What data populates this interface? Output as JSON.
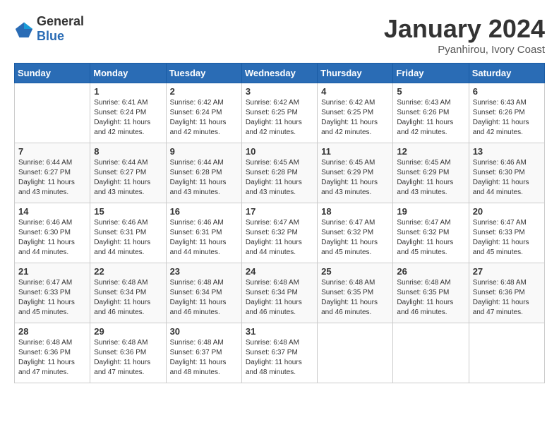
{
  "header": {
    "logo": {
      "general": "General",
      "blue": "Blue"
    },
    "title": "January 2024",
    "subtitle": "Pyanhirou, Ivory Coast"
  },
  "weekdays": [
    "Sunday",
    "Monday",
    "Tuesday",
    "Wednesday",
    "Thursday",
    "Friday",
    "Saturday"
  ],
  "weeks": [
    [
      {
        "day": "",
        "sunrise": "",
        "sunset": "",
        "daylight": ""
      },
      {
        "day": "1",
        "sunrise": "Sunrise: 6:41 AM",
        "sunset": "Sunset: 6:24 PM",
        "daylight": "Daylight: 11 hours and 42 minutes."
      },
      {
        "day": "2",
        "sunrise": "Sunrise: 6:42 AM",
        "sunset": "Sunset: 6:24 PM",
        "daylight": "Daylight: 11 hours and 42 minutes."
      },
      {
        "day": "3",
        "sunrise": "Sunrise: 6:42 AM",
        "sunset": "Sunset: 6:25 PM",
        "daylight": "Daylight: 11 hours and 42 minutes."
      },
      {
        "day": "4",
        "sunrise": "Sunrise: 6:42 AM",
        "sunset": "Sunset: 6:25 PM",
        "daylight": "Daylight: 11 hours and 42 minutes."
      },
      {
        "day": "5",
        "sunrise": "Sunrise: 6:43 AM",
        "sunset": "Sunset: 6:26 PM",
        "daylight": "Daylight: 11 hours and 42 minutes."
      },
      {
        "day": "6",
        "sunrise": "Sunrise: 6:43 AM",
        "sunset": "Sunset: 6:26 PM",
        "daylight": "Daylight: 11 hours and 42 minutes."
      }
    ],
    [
      {
        "day": "7",
        "sunrise": "Sunrise: 6:44 AM",
        "sunset": "Sunset: 6:27 PM",
        "daylight": "Daylight: 11 hours and 43 minutes."
      },
      {
        "day": "8",
        "sunrise": "Sunrise: 6:44 AM",
        "sunset": "Sunset: 6:27 PM",
        "daylight": "Daylight: 11 hours and 43 minutes."
      },
      {
        "day": "9",
        "sunrise": "Sunrise: 6:44 AM",
        "sunset": "Sunset: 6:28 PM",
        "daylight": "Daylight: 11 hours and 43 minutes."
      },
      {
        "day": "10",
        "sunrise": "Sunrise: 6:45 AM",
        "sunset": "Sunset: 6:28 PM",
        "daylight": "Daylight: 11 hours and 43 minutes."
      },
      {
        "day": "11",
        "sunrise": "Sunrise: 6:45 AM",
        "sunset": "Sunset: 6:29 PM",
        "daylight": "Daylight: 11 hours and 43 minutes."
      },
      {
        "day": "12",
        "sunrise": "Sunrise: 6:45 AM",
        "sunset": "Sunset: 6:29 PM",
        "daylight": "Daylight: 11 hours and 43 minutes."
      },
      {
        "day": "13",
        "sunrise": "Sunrise: 6:46 AM",
        "sunset": "Sunset: 6:30 PM",
        "daylight": "Daylight: 11 hours and 44 minutes."
      }
    ],
    [
      {
        "day": "14",
        "sunrise": "Sunrise: 6:46 AM",
        "sunset": "Sunset: 6:30 PM",
        "daylight": "Daylight: 11 hours and 44 minutes."
      },
      {
        "day": "15",
        "sunrise": "Sunrise: 6:46 AM",
        "sunset": "Sunset: 6:31 PM",
        "daylight": "Daylight: 11 hours and 44 minutes."
      },
      {
        "day": "16",
        "sunrise": "Sunrise: 6:46 AM",
        "sunset": "Sunset: 6:31 PM",
        "daylight": "Daylight: 11 hours and 44 minutes."
      },
      {
        "day": "17",
        "sunrise": "Sunrise: 6:47 AM",
        "sunset": "Sunset: 6:32 PM",
        "daylight": "Daylight: 11 hours and 44 minutes."
      },
      {
        "day": "18",
        "sunrise": "Sunrise: 6:47 AM",
        "sunset": "Sunset: 6:32 PM",
        "daylight": "Daylight: 11 hours and 45 minutes."
      },
      {
        "day": "19",
        "sunrise": "Sunrise: 6:47 AM",
        "sunset": "Sunset: 6:32 PM",
        "daylight": "Daylight: 11 hours and 45 minutes."
      },
      {
        "day": "20",
        "sunrise": "Sunrise: 6:47 AM",
        "sunset": "Sunset: 6:33 PM",
        "daylight": "Daylight: 11 hours and 45 minutes."
      }
    ],
    [
      {
        "day": "21",
        "sunrise": "Sunrise: 6:47 AM",
        "sunset": "Sunset: 6:33 PM",
        "daylight": "Daylight: 11 hours and 45 minutes."
      },
      {
        "day": "22",
        "sunrise": "Sunrise: 6:48 AM",
        "sunset": "Sunset: 6:34 PM",
        "daylight": "Daylight: 11 hours and 46 minutes."
      },
      {
        "day": "23",
        "sunrise": "Sunrise: 6:48 AM",
        "sunset": "Sunset: 6:34 PM",
        "daylight": "Daylight: 11 hours and 46 minutes."
      },
      {
        "day": "24",
        "sunrise": "Sunrise: 6:48 AM",
        "sunset": "Sunset: 6:34 PM",
        "daylight": "Daylight: 11 hours and 46 minutes."
      },
      {
        "day": "25",
        "sunrise": "Sunrise: 6:48 AM",
        "sunset": "Sunset: 6:35 PM",
        "daylight": "Daylight: 11 hours and 46 minutes."
      },
      {
        "day": "26",
        "sunrise": "Sunrise: 6:48 AM",
        "sunset": "Sunset: 6:35 PM",
        "daylight": "Daylight: 11 hours and 46 minutes."
      },
      {
        "day": "27",
        "sunrise": "Sunrise: 6:48 AM",
        "sunset": "Sunset: 6:36 PM",
        "daylight": "Daylight: 11 hours and 47 minutes."
      }
    ],
    [
      {
        "day": "28",
        "sunrise": "Sunrise: 6:48 AM",
        "sunset": "Sunset: 6:36 PM",
        "daylight": "Daylight: 11 hours and 47 minutes."
      },
      {
        "day": "29",
        "sunrise": "Sunrise: 6:48 AM",
        "sunset": "Sunset: 6:36 PM",
        "daylight": "Daylight: 11 hours and 47 minutes."
      },
      {
        "day": "30",
        "sunrise": "Sunrise: 6:48 AM",
        "sunset": "Sunset: 6:37 PM",
        "daylight": "Daylight: 11 hours and 48 minutes."
      },
      {
        "day": "31",
        "sunrise": "Sunrise: 6:48 AM",
        "sunset": "Sunset: 6:37 PM",
        "daylight": "Daylight: 11 hours and 48 minutes."
      },
      {
        "day": "",
        "sunrise": "",
        "sunset": "",
        "daylight": ""
      },
      {
        "day": "",
        "sunrise": "",
        "sunset": "",
        "daylight": ""
      },
      {
        "day": "",
        "sunrise": "",
        "sunset": "",
        "daylight": ""
      }
    ]
  ]
}
